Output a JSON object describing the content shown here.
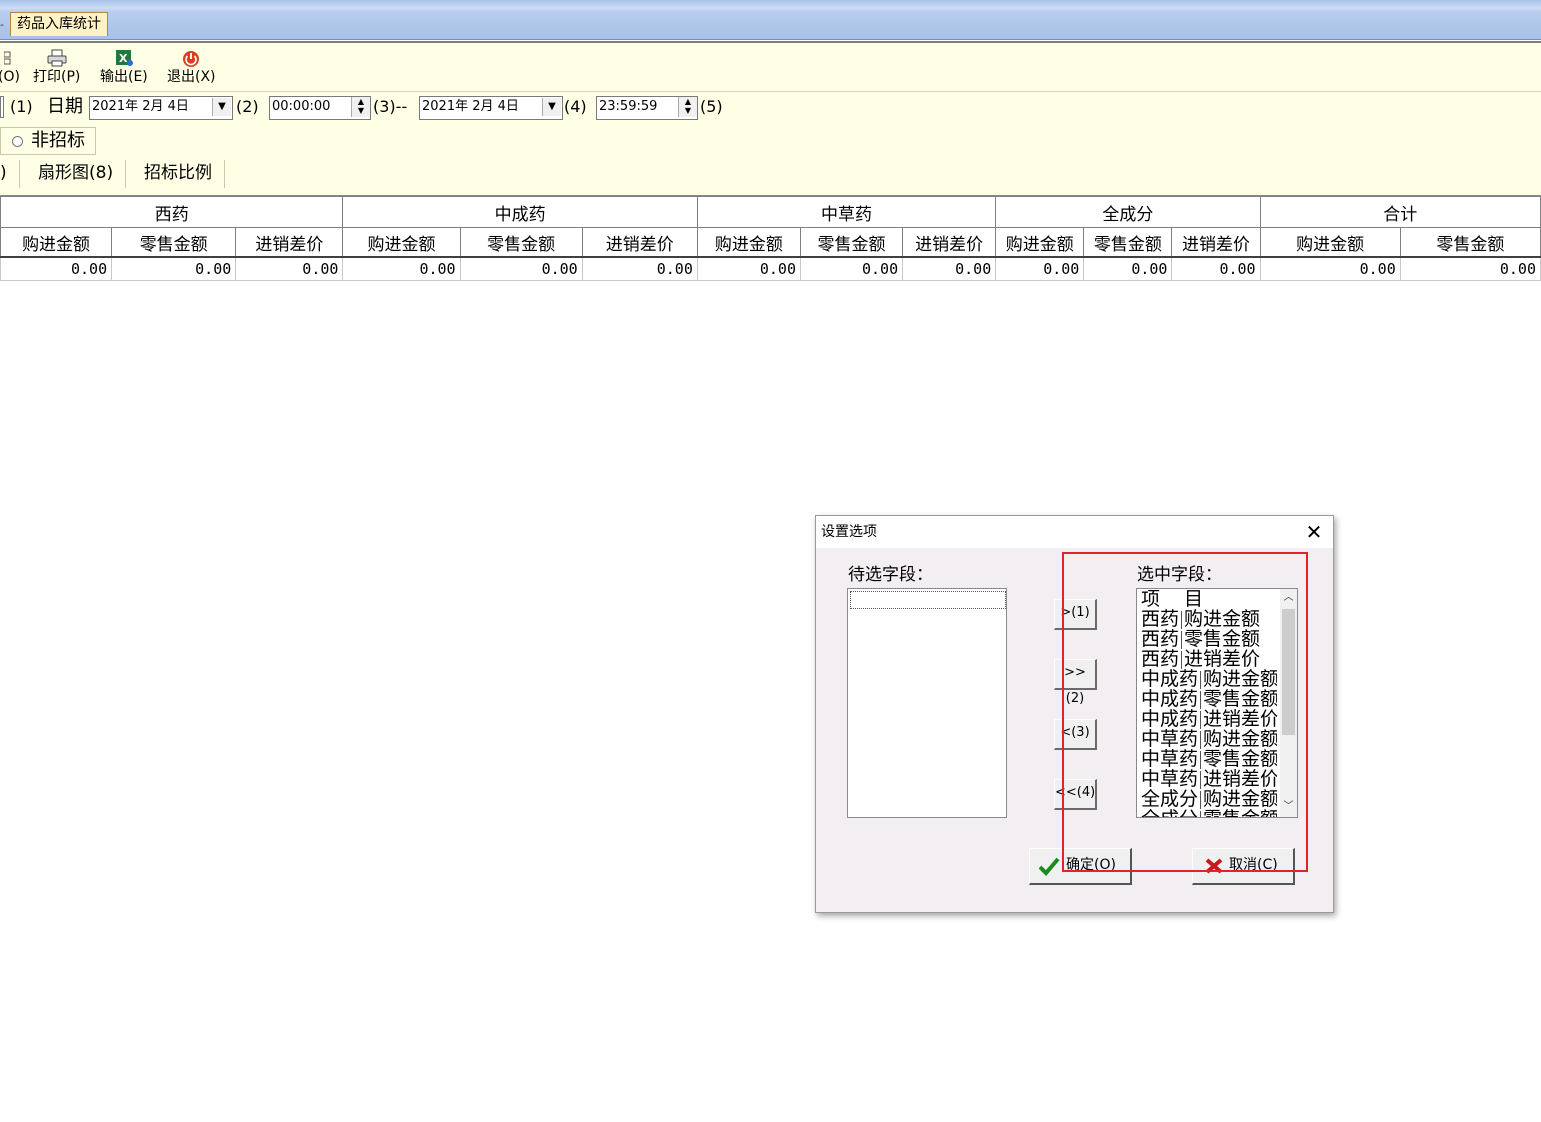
{
  "window": {
    "tab_title": "药品入库统计",
    "tab_left_glyph": "-"
  },
  "toolbar": {
    "cut_label": "(O)",
    "print_label": "打印(P)",
    "export_label": "输出(E)",
    "exit_label": "退出(X)"
  },
  "filter": {
    "mark1": "(1)",
    "date_label": "日期",
    "start_date": "2021年 2月 4日",
    "mark2": "(2)",
    "start_time": "00:00:00",
    "mark3": "(3)--",
    "end_date": "2021年 2月 4日",
    "mark4": "(4)",
    "end_time": "23:59:59",
    "mark5": "(5)",
    "radio_label": "非招标"
  },
  "tabs": {
    "t0": ")",
    "t1": "扇形图(8)",
    "t2": "招标比例"
  },
  "grid": {
    "groups": [
      "西药",
      "中成药",
      "中草药",
      "全成分",
      "合计"
    ],
    "columns": [
      "购进金额",
      "零售金额",
      "进销差价",
      "购进金额",
      "零售金额",
      "进销差价",
      "购进金额",
      "零售金额",
      "进销差价",
      "购进金额",
      "零售金额",
      "进销差价",
      "购进金额",
      "零售金额"
    ],
    "row": [
      "0.00",
      "0.00",
      "0.00",
      "0.00",
      "0.00",
      "0.00",
      "0.00",
      "0.00",
      "0.00",
      "0.00",
      "0.00",
      "0.00",
      "0.00",
      "0.00"
    ]
  },
  "dialog": {
    "title": "设置选项",
    "close_glyph": "✕",
    "available_label": "待选字段：",
    "selected_label": "选中字段：",
    "selected_items": [
      [
        "项",
        "目"
      ],
      [
        "西药",
        "购进金额"
      ],
      [
        "西药",
        "零售金额"
      ],
      [
        "西药",
        "进销差价"
      ],
      [
        "中成药",
        "购进金额"
      ],
      [
        "中成药",
        "零售金额"
      ],
      [
        "中成药",
        "进销差价"
      ],
      [
        "中草药",
        "购进金额"
      ],
      [
        "中草药",
        "零售金额"
      ],
      [
        "中草药",
        "进销差价"
      ],
      [
        "全成分",
        "购进金额"
      ],
      [
        "全成分",
        "零售金额"
      ]
    ],
    "move_buttons": [
      ">(1)",
      ">>(2)",
      "<(3)",
      "<<(4)"
    ],
    "ok_label": "确定(O)",
    "cancel_label": "取消(C)"
  }
}
